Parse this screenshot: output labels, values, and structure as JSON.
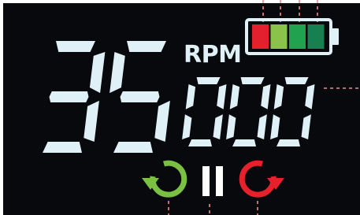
{
  "display": {
    "rpm_value": "35000",
    "rpm_unit": "RPM",
    "colors": {
      "background": "#07090c",
      "segment": "#dff0f7",
      "callout": "#f08a8a"
    }
  },
  "battery": {
    "cells": [
      {
        "name": "cell-1",
        "color": "#e3202e"
      },
      {
        "name": "cell-2",
        "color": "#8bc34a"
      },
      {
        "name": "cell-3",
        "color": "#20a24f"
      },
      {
        "name": "cell-4",
        "color": "#168051"
      }
    ],
    "outline_color": "#dff0f7"
  },
  "controls": {
    "counterclockwise": {
      "icon": "rotate-counterclockwise-icon",
      "color": "#7ac143"
    },
    "pause": {
      "icon": "pause-icon",
      "color": "#ffffff"
    },
    "clockwise": {
      "icon": "rotate-clockwise-icon",
      "color": "#e8202b"
    }
  }
}
